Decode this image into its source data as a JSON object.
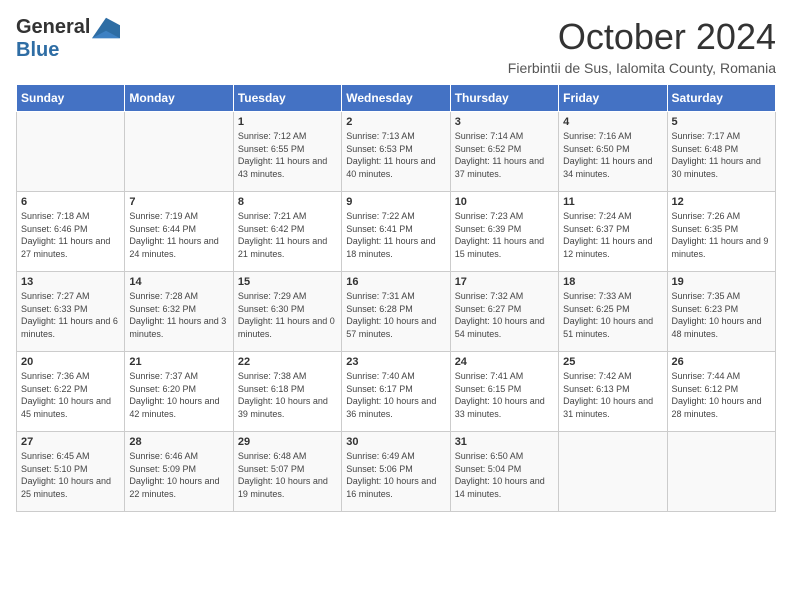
{
  "logo": {
    "general": "General",
    "blue": "Blue"
  },
  "title": "October 2024",
  "subtitle": "Fierbintii de Sus, Ialomita County, Romania",
  "days": [
    "Sunday",
    "Monday",
    "Tuesday",
    "Wednesday",
    "Thursday",
    "Friday",
    "Saturday"
  ],
  "weeks": [
    [
      {
        "day": "",
        "info": ""
      },
      {
        "day": "",
        "info": ""
      },
      {
        "day": "1",
        "info": "Sunrise: 7:12 AM\nSunset: 6:55 PM\nDaylight: 11 hours and 43 minutes."
      },
      {
        "day": "2",
        "info": "Sunrise: 7:13 AM\nSunset: 6:53 PM\nDaylight: 11 hours and 40 minutes."
      },
      {
        "day": "3",
        "info": "Sunrise: 7:14 AM\nSunset: 6:52 PM\nDaylight: 11 hours and 37 minutes."
      },
      {
        "day": "4",
        "info": "Sunrise: 7:16 AM\nSunset: 6:50 PM\nDaylight: 11 hours and 34 minutes."
      },
      {
        "day": "5",
        "info": "Sunrise: 7:17 AM\nSunset: 6:48 PM\nDaylight: 11 hours and 30 minutes."
      }
    ],
    [
      {
        "day": "6",
        "info": "Sunrise: 7:18 AM\nSunset: 6:46 PM\nDaylight: 11 hours and 27 minutes."
      },
      {
        "day": "7",
        "info": "Sunrise: 7:19 AM\nSunset: 6:44 PM\nDaylight: 11 hours and 24 minutes."
      },
      {
        "day": "8",
        "info": "Sunrise: 7:21 AM\nSunset: 6:42 PM\nDaylight: 11 hours and 21 minutes."
      },
      {
        "day": "9",
        "info": "Sunrise: 7:22 AM\nSunset: 6:41 PM\nDaylight: 11 hours and 18 minutes."
      },
      {
        "day": "10",
        "info": "Sunrise: 7:23 AM\nSunset: 6:39 PM\nDaylight: 11 hours and 15 minutes."
      },
      {
        "day": "11",
        "info": "Sunrise: 7:24 AM\nSunset: 6:37 PM\nDaylight: 11 hours and 12 minutes."
      },
      {
        "day": "12",
        "info": "Sunrise: 7:26 AM\nSunset: 6:35 PM\nDaylight: 11 hours and 9 minutes."
      }
    ],
    [
      {
        "day": "13",
        "info": "Sunrise: 7:27 AM\nSunset: 6:33 PM\nDaylight: 11 hours and 6 minutes."
      },
      {
        "day": "14",
        "info": "Sunrise: 7:28 AM\nSunset: 6:32 PM\nDaylight: 11 hours and 3 minutes."
      },
      {
        "day": "15",
        "info": "Sunrise: 7:29 AM\nSunset: 6:30 PM\nDaylight: 11 hours and 0 minutes."
      },
      {
        "day": "16",
        "info": "Sunrise: 7:31 AM\nSunset: 6:28 PM\nDaylight: 10 hours and 57 minutes."
      },
      {
        "day": "17",
        "info": "Sunrise: 7:32 AM\nSunset: 6:27 PM\nDaylight: 10 hours and 54 minutes."
      },
      {
        "day": "18",
        "info": "Sunrise: 7:33 AM\nSunset: 6:25 PM\nDaylight: 10 hours and 51 minutes."
      },
      {
        "day": "19",
        "info": "Sunrise: 7:35 AM\nSunset: 6:23 PM\nDaylight: 10 hours and 48 minutes."
      }
    ],
    [
      {
        "day": "20",
        "info": "Sunrise: 7:36 AM\nSunset: 6:22 PM\nDaylight: 10 hours and 45 minutes."
      },
      {
        "day": "21",
        "info": "Sunrise: 7:37 AM\nSunset: 6:20 PM\nDaylight: 10 hours and 42 minutes."
      },
      {
        "day": "22",
        "info": "Sunrise: 7:38 AM\nSunset: 6:18 PM\nDaylight: 10 hours and 39 minutes."
      },
      {
        "day": "23",
        "info": "Sunrise: 7:40 AM\nSunset: 6:17 PM\nDaylight: 10 hours and 36 minutes."
      },
      {
        "day": "24",
        "info": "Sunrise: 7:41 AM\nSunset: 6:15 PM\nDaylight: 10 hours and 33 minutes."
      },
      {
        "day": "25",
        "info": "Sunrise: 7:42 AM\nSunset: 6:13 PM\nDaylight: 10 hours and 31 minutes."
      },
      {
        "day": "26",
        "info": "Sunrise: 7:44 AM\nSunset: 6:12 PM\nDaylight: 10 hours and 28 minutes."
      }
    ],
    [
      {
        "day": "27",
        "info": "Sunrise: 6:45 AM\nSunset: 5:10 PM\nDaylight: 10 hours and 25 minutes."
      },
      {
        "day": "28",
        "info": "Sunrise: 6:46 AM\nSunset: 5:09 PM\nDaylight: 10 hours and 22 minutes."
      },
      {
        "day": "29",
        "info": "Sunrise: 6:48 AM\nSunset: 5:07 PM\nDaylight: 10 hours and 19 minutes."
      },
      {
        "day": "30",
        "info": "Sunrise: 6:49 AM\nSunset: 5:06 PM\nDaylight: 10 hours and 16 minutes."
      },
      {
        "day": "31",
        "info": "Sunrise: 6:50 AM\nSunset: 5:04 PM\nDaylight: 10 hours and 14 minutes."
      },
      {
        "day": "",
        "info": ""
      },
      {
        "day": "",
        "info": ""
      }
    ]
  ]
}
